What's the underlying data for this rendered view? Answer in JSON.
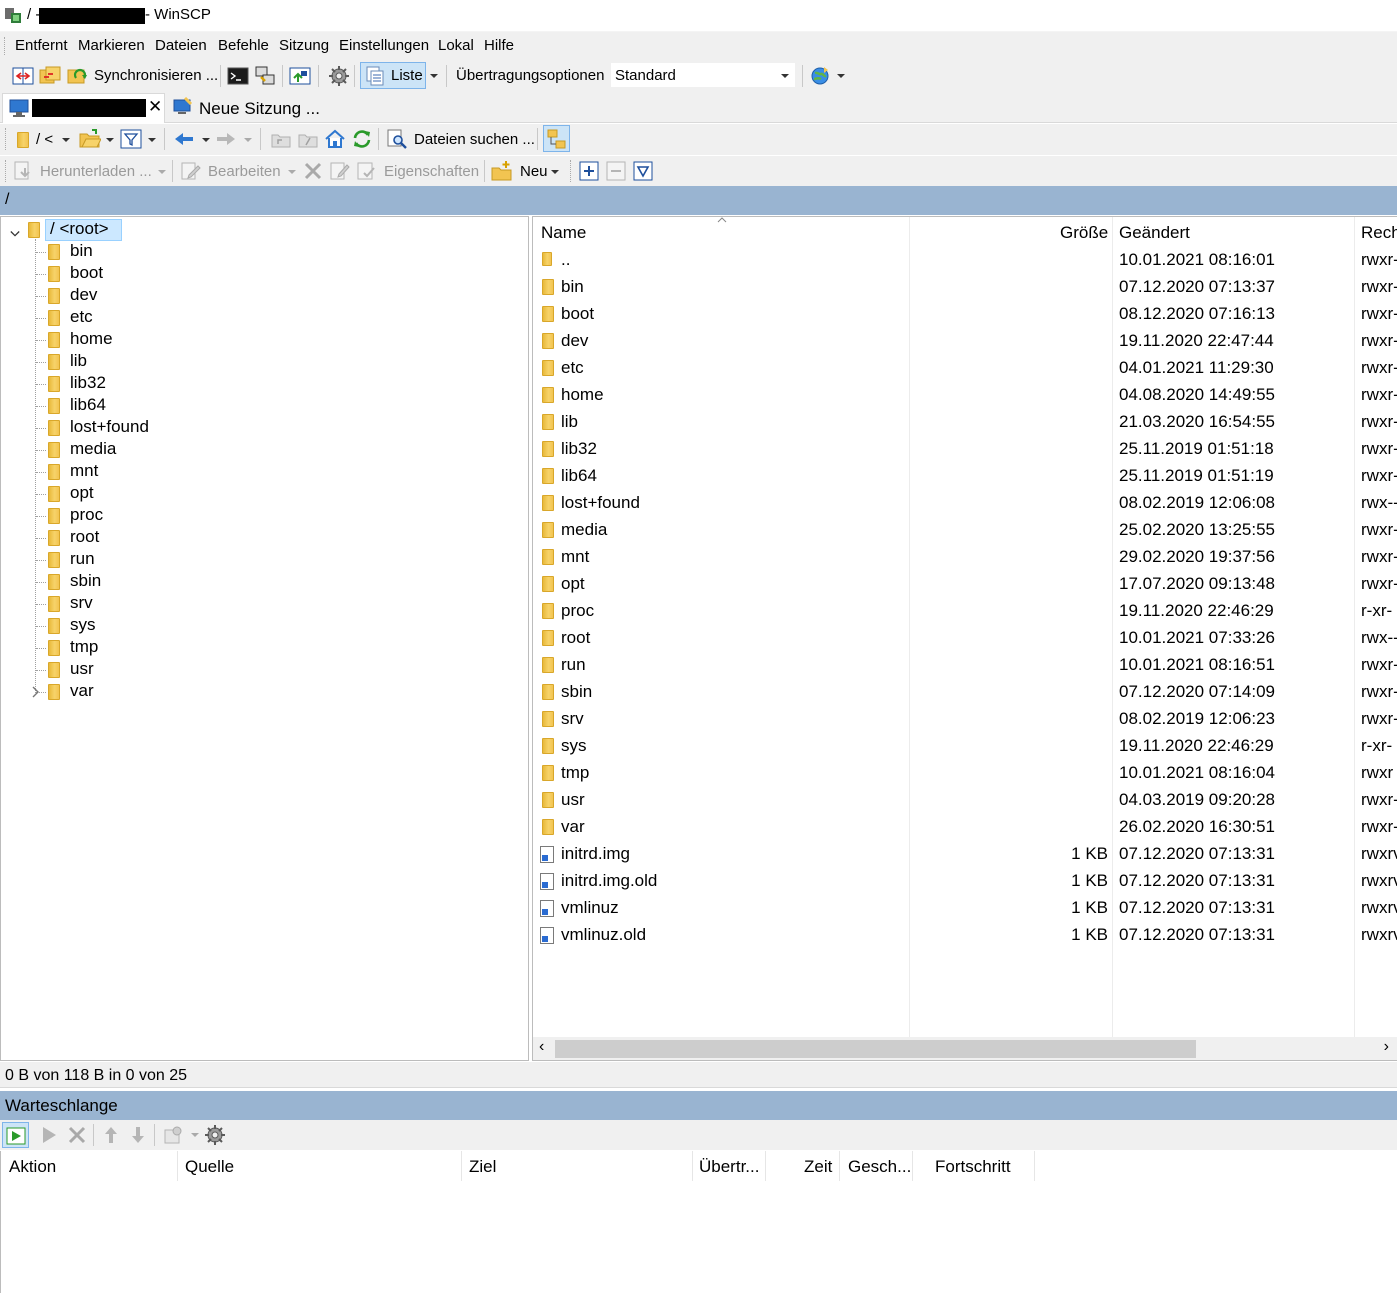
{
  "window": {
    "title_path": "/ -",
    "title_app": "- WinSCP"
  },
  "menu": [
    "Entfernt",
    "Markieren",
    "Dateien",
    "Befehle",
    "Sitzung",
    "Einstellungen",
    "Lokal",
    "Hilfe"
  ],
  "main_toolbar": {
    "synchronize_label": "Synchronisieren ...",
    "view_label": "Liste",
    "transfer_options_label": "Übertragungsoptionen",
    "transfer_preset": "Standard"
  },
  "tabs": {
    "new_session_label": "Neue Sitzung ..."
  },
  "nav_toolbar": {
    "path_label": "/ <",
    "find_files_label": "Dateien suchen ..."
  },
  "file_toolbar": {
    "download_label": "Herunterladen ...",
    "edit_label": "Bearbeiten",
    "properties_label": "Eigenschaften",
    "new_label": "Neu"
  },
  "path_bar": "/",
  "tree": {
    "root_label": "/ <root>",
    "folders": [
      "bin",
      "boot",
      "dev",
      "etc",
      "home",
      "lib",
      "lib32",
      "lib64",
      "lost+found",
      "media",
      "mnt",
      "opt",
      "proc",
      "root",
      "run",
      "sbin",
      "srv",
      "sys",
      "tmp",
      "usr",
      "var"
    ]
  },
  "file_list": {
    "columns": {
      "name": "Name",
      "size": "Größe",
      "changed": "Geändert",
      "rights": "Rech"
    },
    "rows": [
      {
        "name": "..",
        "size": "",
        "changed": "10.01.2021 08:16:01",
        "rights": "rwxr-",
        "type": "parent"
      },
      {
        "name": "bin",
        "size": "",
        "changed": "07.12.2020 07:13:37",
        "rights": "rwxr-",
        "type": "folder"
      },
      {
        "name": "boot",
        "size": "",
        "changed": "08.12.2020 07:16:13",
        "rights": "rwxr-",
        "type": "folder"
      },
      {
        "name": "dev",
        "size": "",
        "changed": "19.11.2020 22:47:44",
        "rights": "rwxr-",
        "type": "folder"
      },
      {
        "name": "etc",
        "size": "",
        "changed": "04.01.2021 11:29:30",
        "rights": "rwxr-",
        "type": "folder"
      },
      {
        "name": "home",
        "size": "",
        "changed": "04.08.2020 14:49:55",
        "rights": "rwxr-",
        "type": "folder"
      },
      {
        "name": "lib",
        "size": "",
        "changed": "21.03.2020 16:54:55",
        "rights": "rwxr-",
        "type": "folder"
      },
      {
        "name": "lib32",
        "size": "",
        "changed": "25.11.2019 01:51:18",
        "rights": "rwxr-",
        "type": "folder"
      },
      {
        "name": "lib64",
        "size": "",
        "changed": "25.11.2019 01:51:19",
        "rights": "rwxr-",
        "type": "folder"
      },
      {
        "name": "lost+found",
        "size": "",
        "changed": "08.02.2019 12:06:08",
        "rights": "rwx--",
        "type": "folder"
      },
      {
        "name": "media",
        "size": "",
        "changed": "25.02.2020 13:25:55",
        "rights": "rwxr-",
        "type": "folder"
      },
      {
        "name": "mnt",
        "size": "",
        "changed": "29.02.2020 19:37:56",
        "rights": "rwxr-",
        "type": "folder"
      },
      {
        "name": "opt",
        "size": "",
        "changed": "17.07.2020 09:13:48",
        "rights": "rwxr-",
        "type": "folder"
      },
      {
        "name": "proc",
        "size": "",
        "changed": "19.11.2020 22:46:29",
        "rights": "r-xr-",
        "type": "folder"
      },
      {
        "name": "root",
        "size": "",
        "changed": "10.01.2021 07:33:26",
        "rights": "rwx--",
        "type": "folder"
      },
      {
        "name": "run",
        "size": "",
        "changed": "10.01.2021 08:16:51",
        "rights": "rwxr-",
        "type": "folder"
      },
      {
        "name": "sbin",
        "size": "",
        "changed": "07.12.2020 07:14:09",
        "rights": "rwxr-",
        "type": "folder"
      },
      {
        "name": "srv",
        "size": "",
        "changed": "08.02.2019 12:06:23",
        "rights": "rwxr-",
        "type": "folder"
      },
      {
        "name": "sys",
        "size": "",
        "changed": "19.11.2020 22:46:29",
        "rights": "r-xr-",
        "type": "folder"
      },
      {
        "name": "tmp",
        "size": "",
        "changed": "10.01.2021 08:16:04",
        "rights": "rwxr",
        "type": "folder"
      },
      {
        "name": "usr",
        "size": "",
        "changed": "04.03.2019 09:20:28",
        "rights": "rwxr-",
        "type": "folder"
      },
      {
        "name": "var",
        "size": "",
        "changed": "26.02.2020 16:30:51",
        "rights": "rwxr-",
        "type": "folder"
      },
      {
        "name": "initrd.img",
        "size": "1 KB",
        "changed": "07.12.2020 07:13:31",
        "rights": "rwxrv",
        "type": "link"
      },
      {
        "name": "initrd.img.old",
        "size": "1 KB",
        "changed": "07.12.2020 07:13:31",
        "rights": "rwxrv",
        "type": "link"
      },
      {
        "name": "vmlinuz",
        "size": "1 KB",
        "changed": "07.12.2020 07:13:31",
        "rights": "rwxrv",
        "type": "link"
      },
      {
        "name": "vmlinuz.old",
        "size": "1 KB",
        "changed": "07.12.2020 07:13:31",
        "rights": "rwxrv",
        "type": "link"
      }
    ]
  },
  "status_bar": "0 B von 118 B in 0 von 25",
  "queue": {
    "title": "Warteschlange",
    "columns": [
      "Aktion",
      "Quelle",
      "Ziel",
      "Übertr...",
      "Zeit",
      "Gesch...",
      "Fortschritt"
    ]
  },
  "colors": {
    "panel_header": "#99b4d1",
    "chrome": "#f0f0f0",
    "folder": "#f2c451"
  }
}
